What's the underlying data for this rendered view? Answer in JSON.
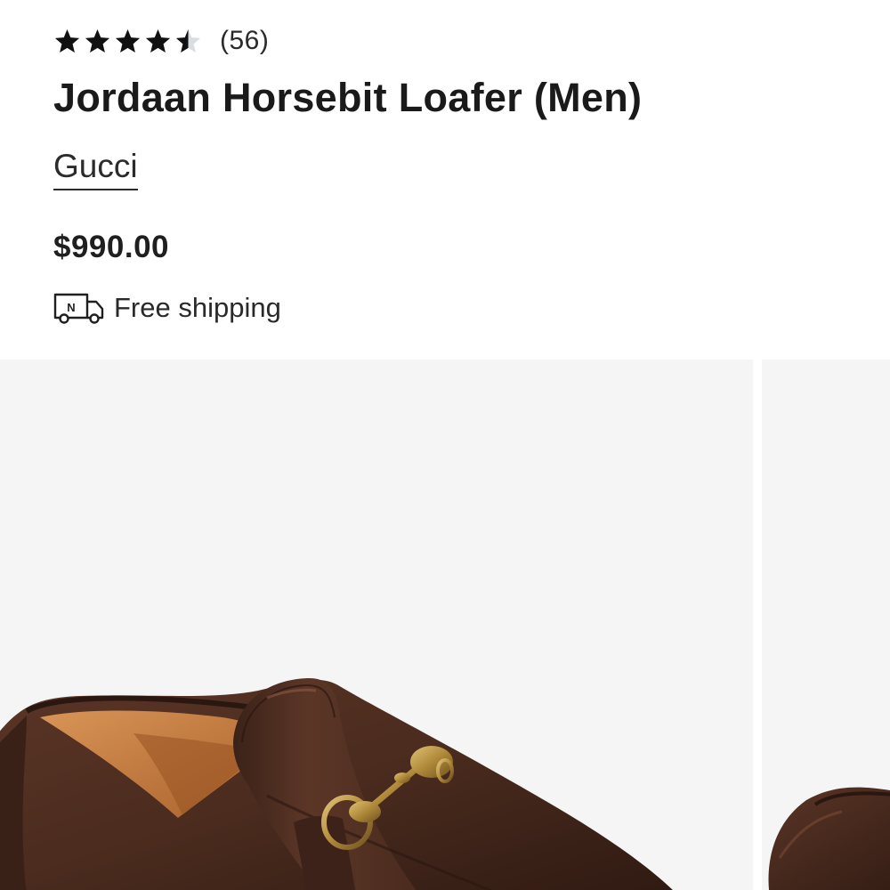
{
  "product": {
    "rating": 4.5,
    "rating_max": 5,
    "review_count": "(56)",
    "title": "Jordaan Horsebit Loafer (Men)",
    "brand": "Gucci",
    "price": "$990.00",
    "shipping_icon": "truck-icon",
    "shipping_icon_letter": "N",
    "shipping_text": "Free shipping"
  },
  "gallery": {
    "images": [
      {
        "name": "main-product-image",
        "subject": "brown leather horsebit loafer"
      },
      {
        "name": "next-product-image",
        "subject": "brown leather loafer"
      }
    ]
  },
  "colors": {
    "text": "#1f1f1f",
    "star": "#111111",
    "star_empty": "#d9dde0",
    "image_bg": "#f5f5f5",
    "leather": "#4a2b1e",
    "lining": "#c77f3f",
    "hardware": "#b08a3a"
  }
}
